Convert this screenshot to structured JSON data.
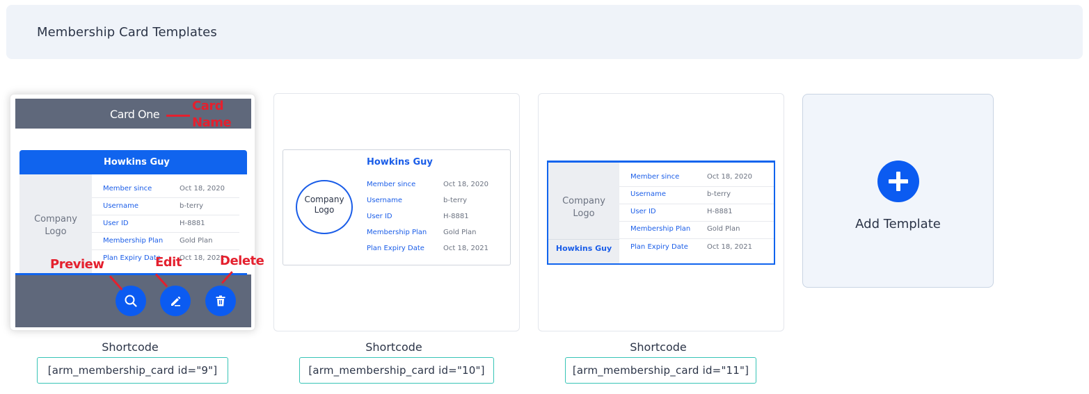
{
  "header": {
    "title": "Membership Card Templates"
  },
  "annotations": {
    "card_name_1": "Card",
    "card_name_2": "Name",
    "preview": "Preview",
    "edit": "Edit",
    "delete": "Delete"
  },
  "card_sample": {
    "member_name": "Howkins Guy",
    "logo_line1": "Company",
    "logo_line2": "Logo",
    "rows": [
      {
        "label": "Member since",
        "value": "Oct 18, 2020"
      },
      {
        "label": "Username",
        "value": "b-terry"
      },
      {
        "label": "User ID",
        "value": "H-8881"
      },
      {
        "label": "Membership Plan",
        "value": "Gold Plan"
      },
      {
        "label": "Plan Expiry Date",
        "value": "Oct 18, 2021"
      }
    ]
  },
  "templates": [
    {
      "card_name": "Card One",
      "shortcode_label": "Shortcode",
      "shortcode": "[arm_membership_card id=\"9\"]"
    },
    {
      "shortcode_label": "Shortcode",
      "shortcode": "[arm_membership_card id=\"10\"]"
    },
    {
      "shortcode_label": "Shortcode",
      "shortcode": "[arm_membership_card id=\"11\"]"
    }
  ],
  "add_template": {
    "label": "Add Template"
  },
  "colors": {
    "primary": "#0b5bf1",
    "annotation": "#e4202e",
    "overlay": "#5f687b",
    "shortcode_border": "#37c4b6"
  },
  "icons": {
    "preview": "search-icon",
    "edit": "pencil-icon",
    "delete": "trash-icon",
    "add": "plus-icon"
  }
}
